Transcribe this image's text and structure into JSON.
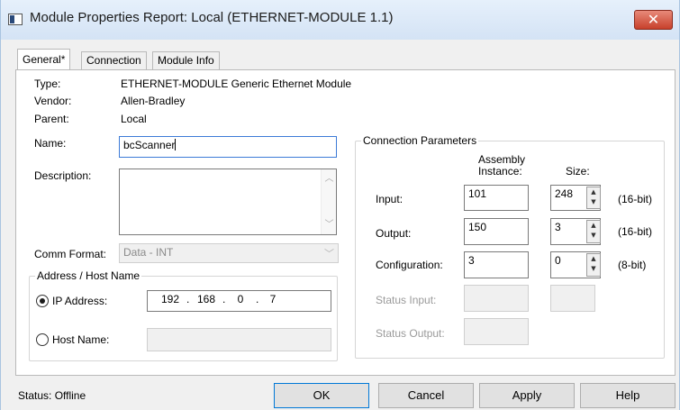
{
  "window": {
    "title": "Module Properties Report: Local (ETHERNET-MODULE 1.1)",
    "close_glyph": "✕"
  },
  "tabs": [
    {
      "label": "General*",
      "active": true
    },
    {
      "label": "Connection",
      "active": false
    },
    {
      "label": "Module Info",
      "active": false
    }
  ],
  "general": {
    "type_label": "Type:",
    "type_value": "ETHERNET-MODULE Generic Ethernet Module",
    "vendor_label": "Vendor:",
    "vendor_value": "Allen-Bradley",
    "parent_label": "Parent:",
    "parent_value": "Local",
    "name_label": "Name:",
    "name_value": "bcScanner",
    "description_label": "Description:",
    "description_value": "",
    "comm_format_label": "Comm Format:",
    "comm_format_value": "Data - INT"
  },
  "address": {
    "group_title": "Address / Host Name",
    "ip_label": "IP Address:",
    "ip_selected": true,
    "ip_octets": [
      "192",
      "168",
      "0",
      "7"
    ],
    "host_label": "Host Name:",
    "host_value": ""
  },
  "connection_params": {
    "group_title": "Connection Parameters",
    "assembly_header_line1": "Assembly",
    "assembly_header_line2": "Instance:",
    "size_header": "Size:",
    "rows": [
      {
        "label": "Input:",
        "instance": "101",
        "size": "248",
        "unit": "(16-bit)"
      },
      {
        "label": "Output:",
        "instance": "150",
        "size": "3",
        "unit": "(16-bit)"
      },
      {
        "label": "Configuration:",
        "instance": "3",
        "size": "0",
        "unit": "(8-bit)"
      }
    ],
    "status_input_label": "Status Input:",
    "status_output_label": "Status Output:"
  },
  "footer": {
    "status_text": "Status:  Offline",
    "ok_label": "OK",
    "cancel_label": "Cancel",
    "apply_label": "Apply",
    "help_label": "Help"
  },
  "colors": {
    "title_bar": "#d4e3f5",
    "close_button": "#c7402b",
    "focus_border": "#3d7bd7"
  },
  "icons": {
    "window_icon": "app-icon",
    "close": "close-icon",
    "combo_arrow": "chevron-down-icon"
  }
}
